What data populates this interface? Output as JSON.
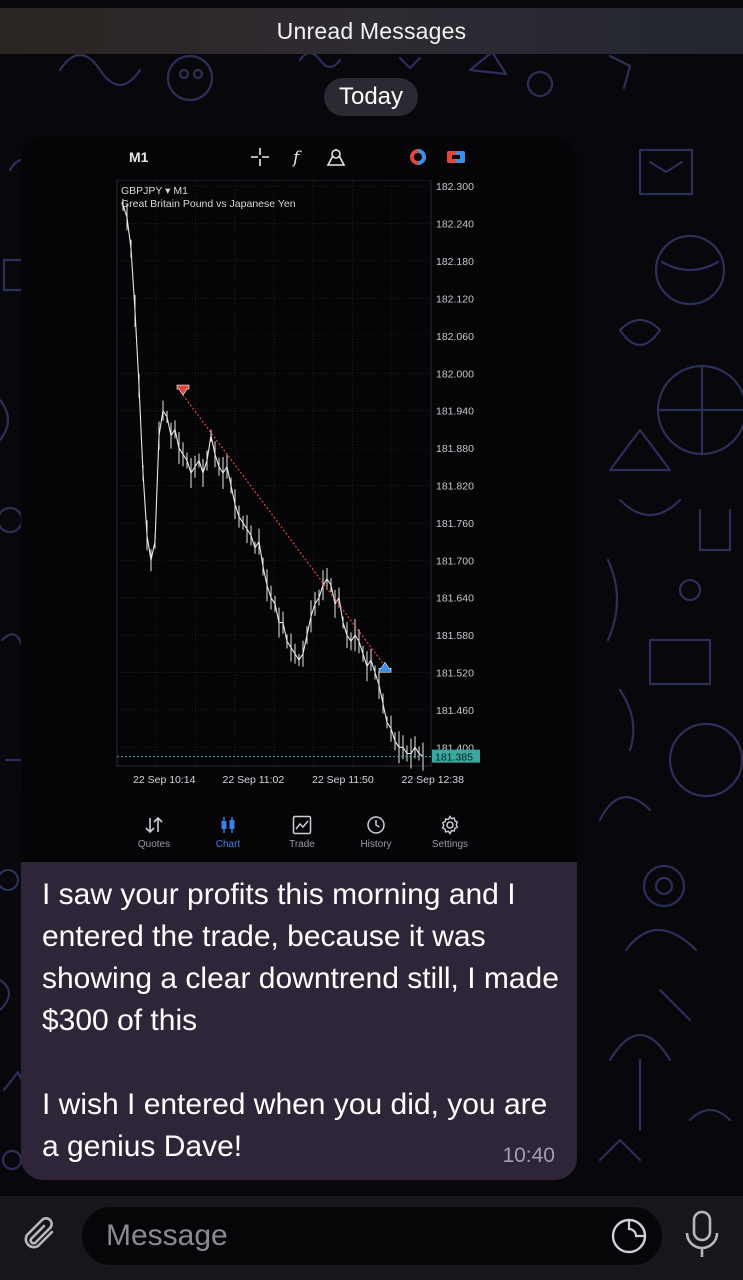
{
  "header": {
    "unread_label": "Unread Messages"
  },
  "date_separator": "Today",
  "message": {
    "text": "I saw your profits this morning and I entered the trade, because it was showing a clear downtrend still, I made $300 of this\n\nI wish I entered when you did, you are a genius Dave!",
    "time": "10:40"
  },
  "screenshot": {
    "timeframe": "M1",
    "toolbar_icons": [
      "crosshair-icon",
      "function-icon",
      "objects-icon",
      "chart-color-icon",
      "trade-toggle-icon"
    ],
    "symbol_line": "GBPJPY ▾ M1",
    "symbol_desc": "Great Britain Pound vs Japanese Yen",
    "current_price": "181.385",
    "up_color": "#ffffff",
    "down_color": "#ffffff",
    "sell_marker_color": "#e0463a",
    "buy_marker_color": "#3d8fe6",
    "trade_line_color": "#e0463a",
    "price_line_color": "#3aa8a0",
    "tabs": [
      {
        "label": "Quotes",
        "icon": "quotes-icon",
        "active": false
      },
      {
        "label": "Chart",
        "icon": "chart-icon",
        "active": true
      },
      {
        "label": "Trade",
        "icon": "trade-icon",
        "active": false
      },
      {
        "label": "History",
        "icon": "history-icon",
        "active": false
      },
      {
        "label": "Settings",
        "icon": "settings-icon",
        "active": false
      }
    ]
  },
  "chart_data": {
    "type": "line",
    "symbol": "GBPJPY",
    "timeframe": "M1",
    "y_ticks": [
      "182.300",
      "182.240",
      "182.180",
      "182.120",
      "182.060",
      "182.000",
      "181.940",
      "181.880",
      "181.820",
      "181.760",
      "181.700",
      "181.640",
      "181.580",
      "181.520",
      "181.460",
      "181.400"
    ],
    "x_ticks": [
      "22 Sep 10:14",
      "22 Sep 11:02",
      "22 Sep 11:50",
      "22 Sep 12:38"
    ],
    "ylim": [
      181.37,
      182.31
    ],
    "grid": true,
    "series": [
      {
        "x": [
          0,
          2,
          4,
          6,
          8,
          10,
          12,
          14,
          16,
          18,
          20,
          22,
          24,
          26,
          28,
          30,
          32,
          34,
          36,
          38,
          40,
          42,
          44,
          46,
          48,
          50,
          52,
          54,
          56,
          58,
          60,
          62,
          64,
          66,
          68,
          70,
          72,
          74,
          76,
          78,
          80,
          82,
          84,
          86,
          88,
          90,
          92,
          94,
          96,
          98,
          100,
          102,
          104,
          106,
          108,
          110,
          112,
          114,
          116,
          118,
          120,
          122,
          124,
          126,
          128,
          130,
          132,
          134,
          136,
          138,
          140,
          142,
          144,
          146,
          148,
          150
        ],
        "values": [
          182.27,
          182.25,
          182.2,
          182.1,
          181.98,
          181.84,
          181.74,
          181.7,
          181.73,
          181.9,
          181.94,
          181.93,
          181.9,
          181.91,
          181.88,
          181.87,
          181.86,
          181.84,
          181.85,
          181.86,
          181.84,
          181.86,
          181.9,
          181.87,
          181.85,
          181.84,
          181.85,
          181.82,
          181.79,
          181.77,
          181.76,
          181.75,
          181.74,
          181.72,
          181.73,
          181.69,
          181.66,
          181.64,
          181.63,
          181.6,
          181.6,
          181.57,
          181.56,
          181.55,
          181.54,
          181.55,
          181.58,
          181.61,
          181.63,
          181.64,
          181.66,
          181.67,
          181.66,
          181.63,
          181.64,
          181.6,
          181.58,
          181.57,
          181.58,
          181.57,
          181.55,
          181.53,
          181.54,
          181.52,
          181.5,
          181.47,
          181.44,
          181.43,
          181.41,
          181.4,
          181.4,
          181.39,
          181.39,
          181.4,
          181.39,
          181.385
        ]
      }
    ],
    "trades": [
      {
        "type": "sell",
        "x": 30,
        "price": 181.965
      },
      {
        "type": "buy",
        "x": 131,
        "price": 181.53
      }
    ]
  },
  "input": {
    "placeholder": "Message"
  }
}
